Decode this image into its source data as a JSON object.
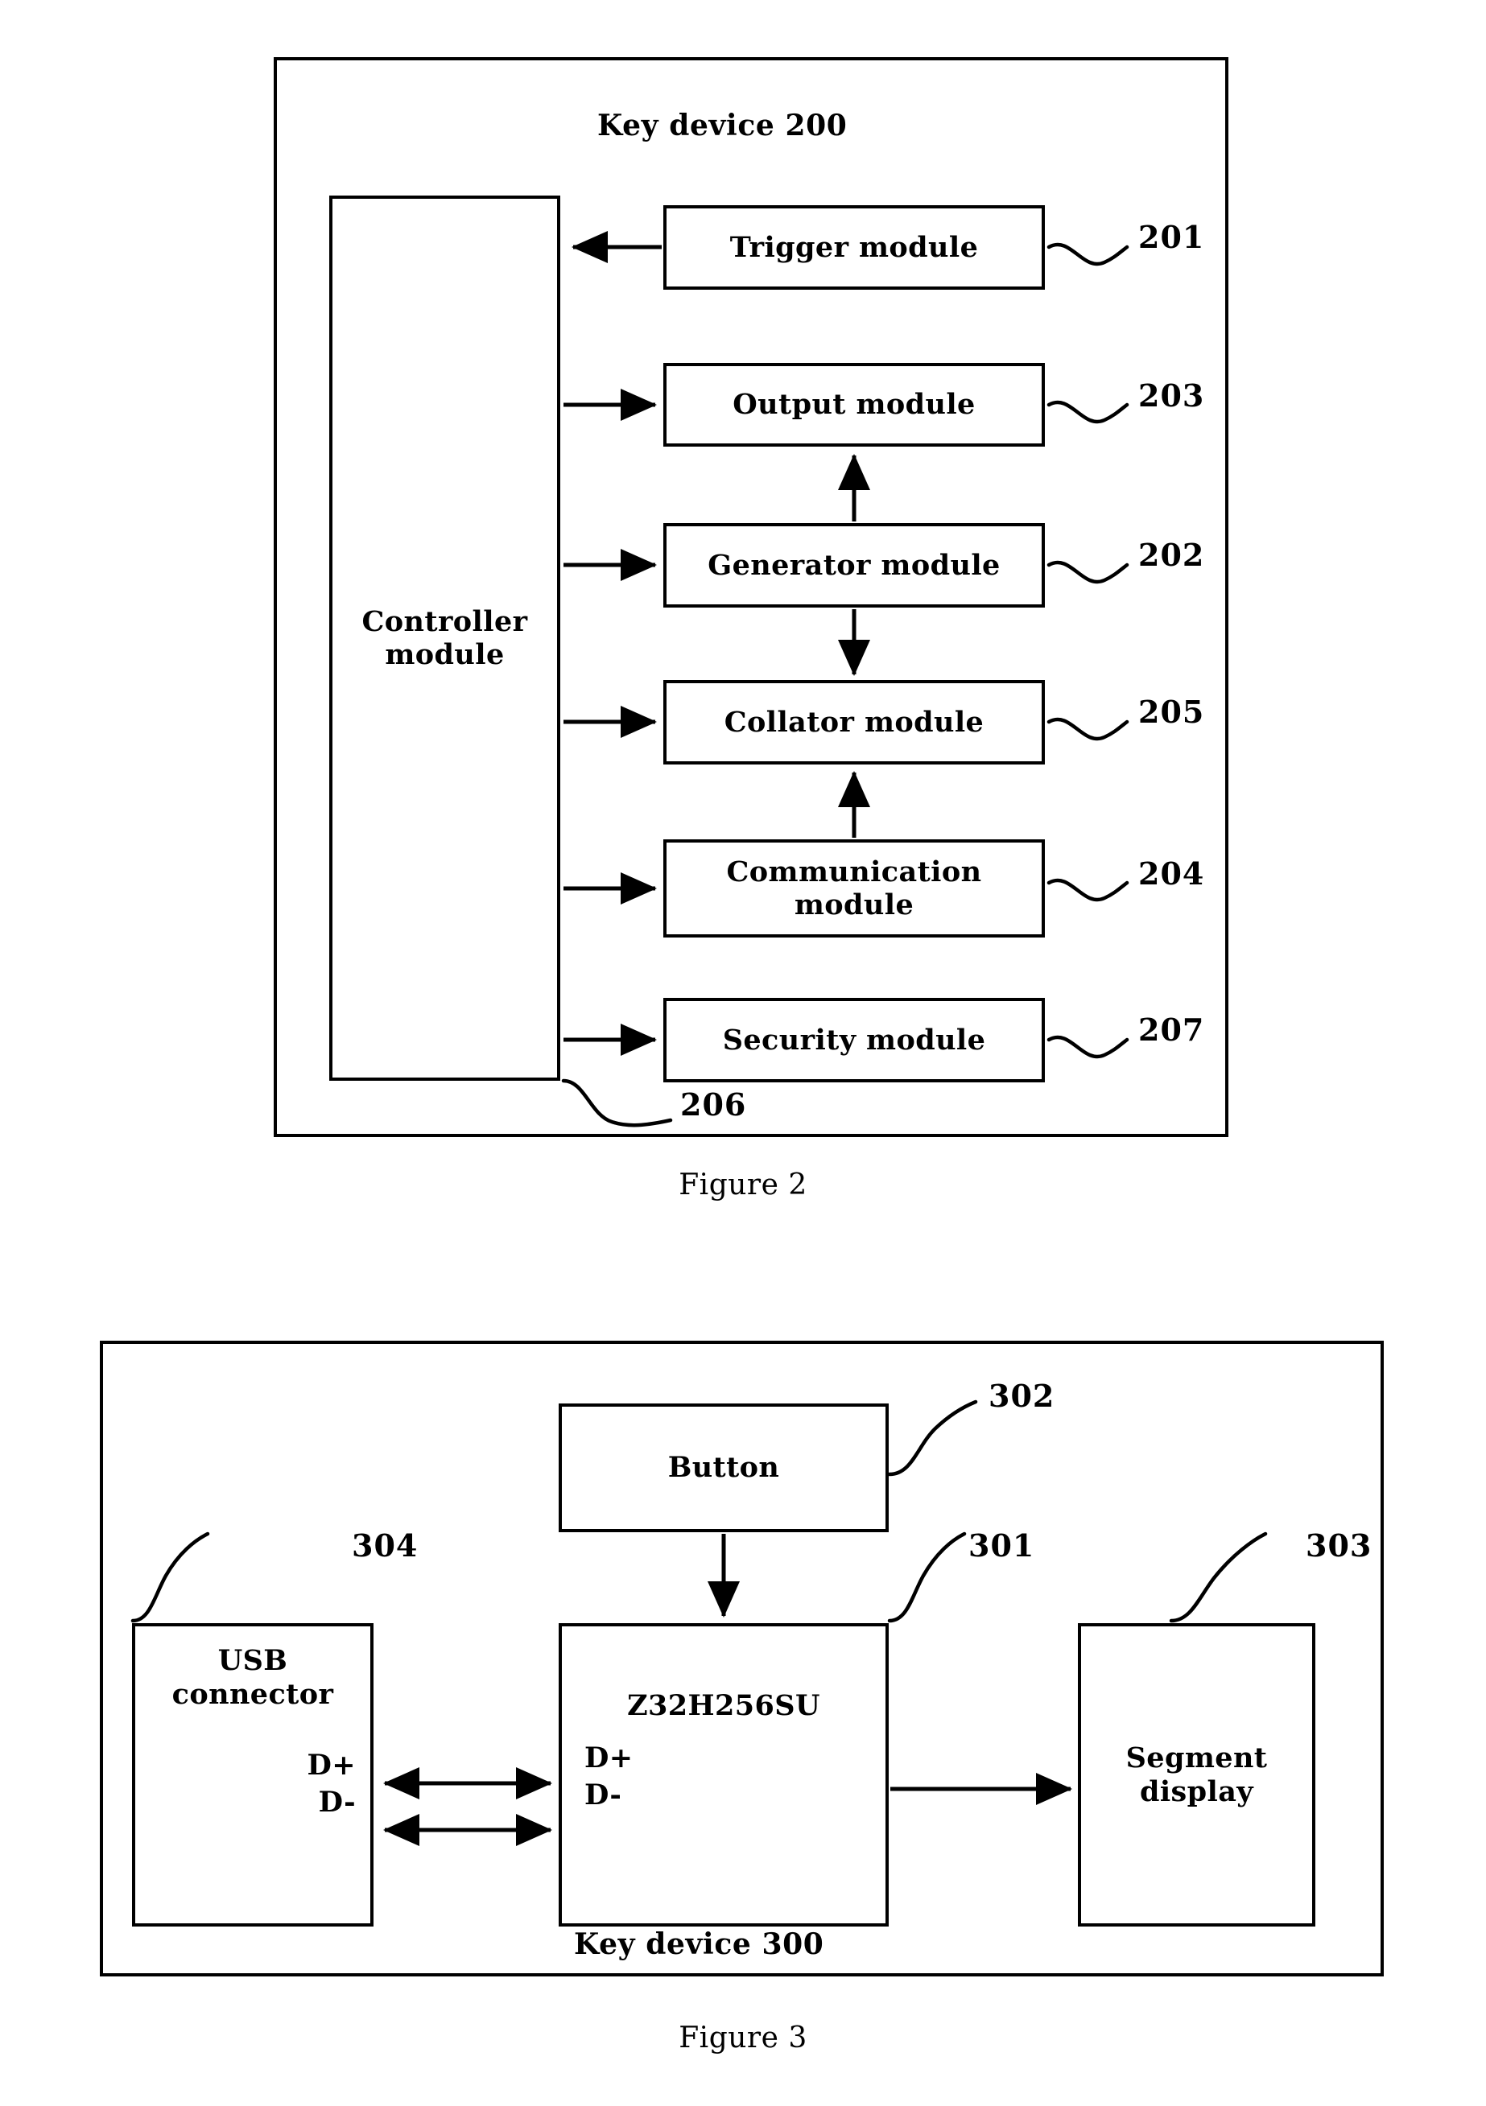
{
  "figure2": {
    "title": "Key device  200",
    "caption": "Figure 2",
    "controller": {
      "line1": "Controller",
      "line2": "module",
      "ref": "206"
    },
    "modules": [
      {
        "label": "Trigger module",
        "ref": "201"
      },
      {
        "label": "Output module",
        "ref": "203"
      },
      {
        "label": "Generator module",
        "ref": "202"
      },
      {
        "label": "Collator module",
        "ref": "205"
      },
      {
        "label_line1": "Communication",
        "label_line2": "module",
        "ref": "204"
      },
      {
        "label": "Security module",
        "ref": "207"
      }
    ]
  },
  "figure3": {
    "caption": "Figure 3",
    "device_label": "Key device 300",
    "button": {
      "label": "Button",
      "ref": "302"
    },
    "usb": {
      "line1": "USB",
      "line2": "connector",
      "ref": "304",
      "pin1": "D+",
      "pin2": "D-"
    },
    "chip": {
      "label": "Z32H256SU",
      "ref": "301",
      "pin1": "D+",
      "pin2": "D-"
    },
    "display": {
      "line1": "Segment",
      "line2": "display",
      "ref": "303"
    }
  },
  "colors": {
    "ink": "#000000",
    "paper": "#ffffff"
  }
}
